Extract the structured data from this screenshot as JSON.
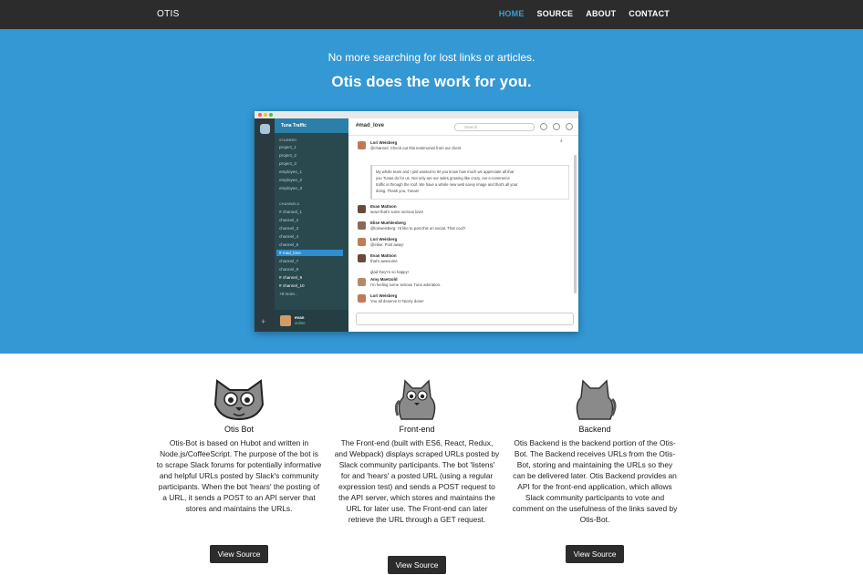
{
  "nav": {
    "brand": "OTIS",
    "items": [
      {
        "label": "HOME",
        "active": true
      },
      {
        "label": "SOURCE",
        "active": false
      },
      {
        "label": "ABOUT",
        "active": false
      },
      {
        "label": "CONTACT",
        "active": false
      }
    ]
  },
  "hero": {
    "subtitle": "No more searching for lost links or articles.",
    "title": "Otis does the work for you.",
    "screenshot": {
      "team_name": "Tuna Traffic",
      "starred_heading": "STARRED",
      "starred": [
        "project_1",
        "project_2",
        "project_3",
        "employee_1",
        "employee_2",
        "employee_3"
      ],
      "channels_heading": "CHANNELS",
      "channels": [
        "# channel_1",
        "channel_2",
        "channel_3",
        "channel_4",
        "channel_5",
        "# mad_love",
        "channel_7",
        "channel_8",
        "# channel_9",
        "# channel_10",
        "+8 more..."
      ],
      "user_name": "evan",
      "user_status": "online",
      "channel_title": "#mad_love",
      "search_placeholder": "Search",
      "member_count": "4",
      "messages": [
        {
          "name": "Lori Weisberg",
          "text": "@channel: Check out this testimonial from our client"
        },
        {
          "name": "Evan Mattson",
          "text": "wow! that's some serious love!"
        },
        {
          "name": "Elise Muehlenberg",
          "text": "@loriweisberg: I'd like to post this on social. That cool?"
        },
        {
          "name": "Lori Weisberg",
          "text": "@elise: Post away!"
        },
        {
          "name": "Evan Mattson",
          "text": "that's awesome"
        },
        {
          "name": "",
          "text": "glad they're so happy!"
        },
        {
          "name": "Amy Maetzold",
          "text": "I'm feeling some serious Tuna adoration."
        },
        {
          "name": "Lori Weisberg",
          "text": "You all deserve it! Nicely done!"
        }
      ],
      "quote": [
        "My whole team and I just wanted to let you know how much we appreciate all that",
        "you Tunas do for us. Not only are our sales growing like crazy, our e-commerce",
        "traffic is through the roof. We have a whole new web savvy image and that's all your",
        "doing. Thank you, Tunas!"
      ]
    }
  },
  "features": [
    {
      "title": "Otis Bot",
      "text": "Otis-Bot is based on Hubot and written in Node.js/CoffeeScript. The purpose of the bot is to scrape Slack forums for potentially informative and helpful URLs posted by Slack's community participants. When the bot 'hears' the posting of a URL, it sends a POST to an API server that stores and maintains the URLs.",
      "button": "View Source",
      "icon": "cat-face-icon"
    },
    {
      "title": "Front-end",
      "text": "The Front-end (built with ES6, React, Redux, and Webpack) displays scraped URLs posted by Slack community participants. The bot 'listens' for and 'hears' a posted URL (using a regular expression test) and sends a POST request to the API server, which stores and maintains the URL for later use. The Front-end can later retrieve the URL through a GET request.",
      "button": "View Source",
      "icon": "cat-front-icon"
    },
    {
      "title": "Backend",
      "text": "Otis Backend is the backend portion of the Otis-Bot. The Backend receives URLs from the Otis-Bot, storing and maintaining the URLs so they can be delivered later. Otis Backend provides an API for the front-end application, which allows Slack community participants to vote and comment on the usefulness of the links saved by Otis-Bot.",
      "button": "View Source",
      "icon": "cat-back-icon"
    }
  ]
}
